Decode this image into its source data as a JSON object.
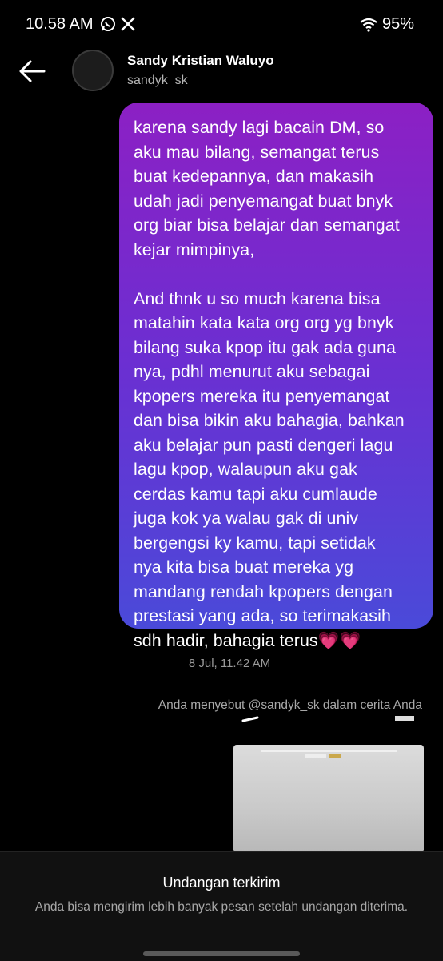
{
  "status_bar": {
    "time": "10.58 AM",
    "battery": "95%",
    "icons": [
      "whatsapp-icon",
      "x-icon",
      "wifi-icon"
    ]
  },
  "header": {
    "name": "Sandy Kristian Waluyo",
    "handle": "sandyk_sk"
  },
  "message": {
    "paragraph1": "karena sandy lagi bacain DM, so\naku mau bilang, semangat terus\nbuat kedepannya, dan makasih\nudah jadi penyemangat buat bnyk\norg biar bisa belajar dan semangat\nkejar mimpinya,",
    "paragraph2": "And thnk u so much karena bisa\nmatahin kata kata org org yg bnyk\nbilang suka kpop itu gak ada guna\nnya, pdhl menurut aku sebagai\nkpopers mereka itu penyemangat\ndan bisa bikin aku bahagia, bahkan\naku belajar pun pasti dengeri lagu\nlagu kpop, walaupun aku gak\ncerdas kamu tapi aku cumlaude\njuga kok ya walau gak di univ\nbergengsi ky kamu, tapi setidak\nnya kita bisa buat mereka yg\nmandang rendah kpopers dengan\nprestasi yang ada, so terimakasih\nsdh hadir, bahagia terus💗💗",
    "gradient_top": "#8c20c4",
    "gradient_bottom": "#4a4ad9"
  },
  "timestamp": "8 Jul, 11.42 AM",
  "mention_note": "Anda menyebut @sandyk_sk dalam cerita Anda",
  "bottom_panel": {
    "title": "Undangan terkirim",
    "body": "Anda bisa mengirim lebih banyak pesan setelah undangan diterima."
  }
}
